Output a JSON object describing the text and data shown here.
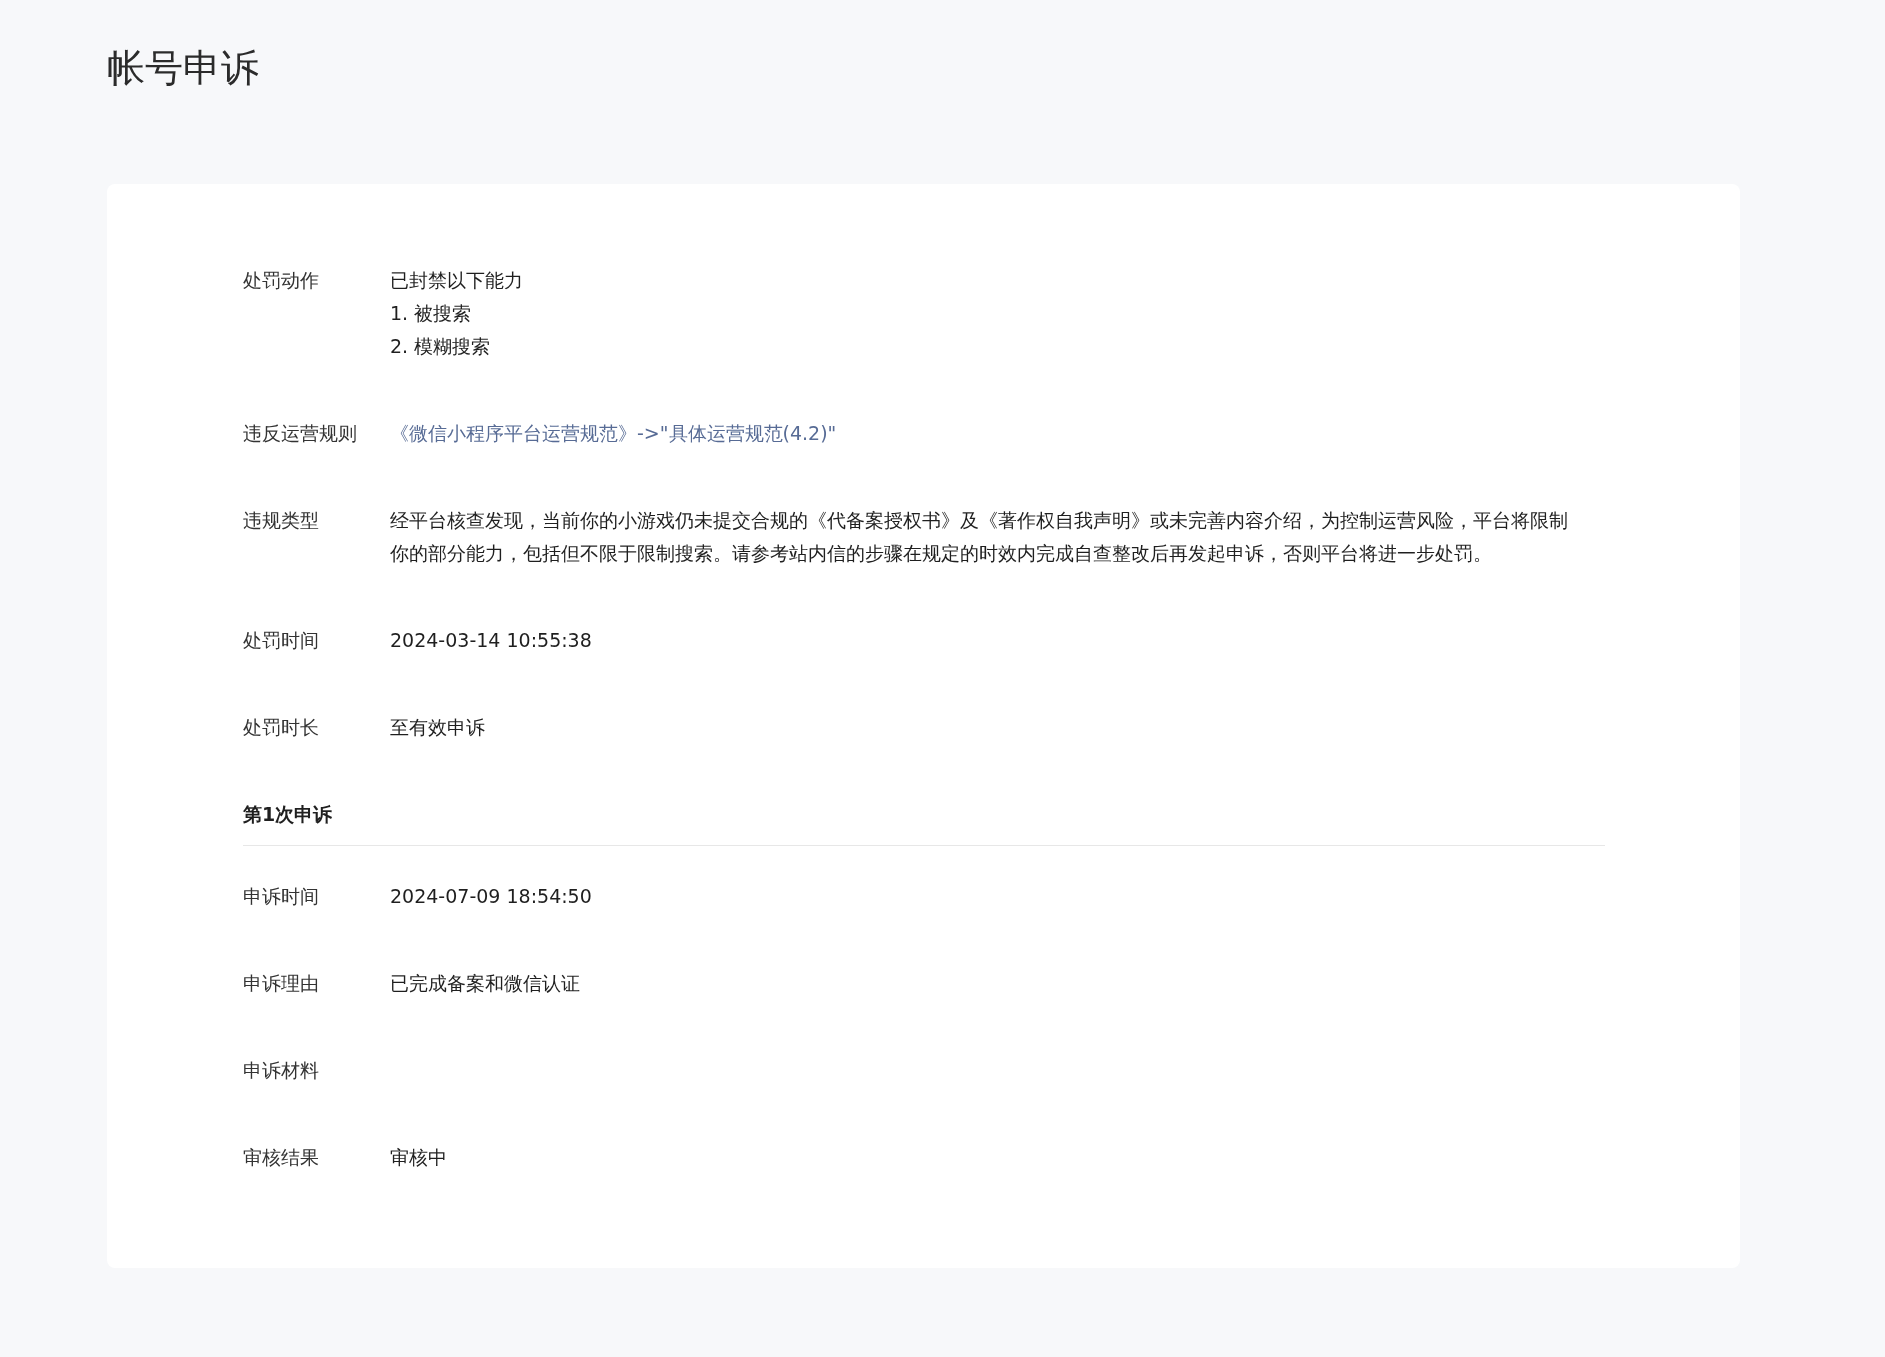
{
  "page_title": "帐号申诉",
  "penalty_rows": [
    {
      "kind": "lines",
      "label": "处罚动作",
      "lines": [
        "已封禁以下能力",
        "1. 被搜索",
        "2. 模糊搜索"
      ]
    },
    {
      "kind": "link",
      "label": "违反运营规则",
      "value": "《微信小程序平台运营规范》->\"具体运营规范(4.2)\""
    },
    {
      "kind": "text",
      "label": "违规类型",
      "value": "经平台核查发现，当前你的小游戏仍未提交合规的《代备案授权书》及《著作权自我声明》或未完善内容介绍，为控制运营风险，平台将限制你的部分能力，包括但不限于限制搜索。请参考站内信的步骤在规定的时效内完成自查整改后再发起申诉，否则平台将进一步处罚。"
    },
    {
      "kind": "text",
      "label": "处罚时间",
      "value": "2024-03-14 10:55:38"
    },
    {
      "kind": "text",
      "label": "处罚时长",
      "value": "至有效申诉"
    }
  ],
  "appeal": {
    "heading": "第1次申诉",
    "rows": [
      {
        "kind": "text",
        "label": "申诉时间",
        "value": "2024-07-09 18:54:50"
      },
      {
        "kind": "text",
        "label": "申诉理由",
        "value": "已完成备案和微信认证"
      },
      {
        "kind": "empty",
        "label": "申诉材料"
      },
      {
        "kind": "text",
        "label": "审核结果",
        "value": "审核中"
      }
    ]
  }
}
